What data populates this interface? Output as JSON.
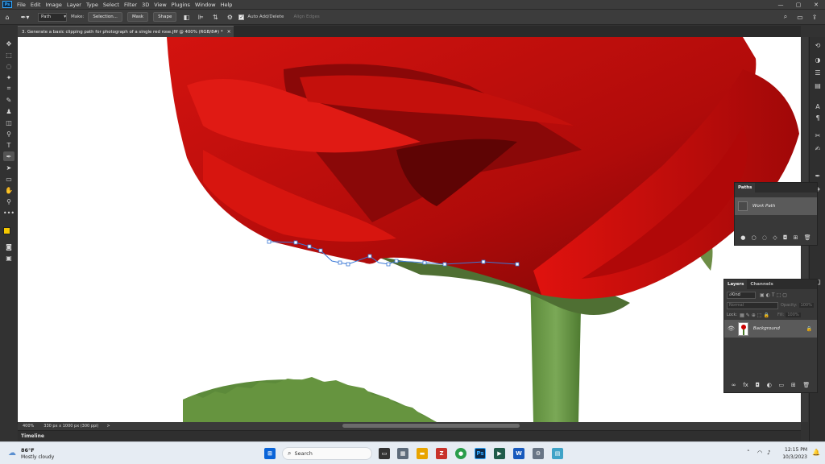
{
  "menu": [
    "File",
    "Edit",
    "Image",
    "Layer",
    "Type",
    "Select",
    "Filter",
    "3D",
    "View",
    "Plugins",
    "Window",
    "Help"
  ],
  "app_logo": "Ps",
  "window_controls": [
    "—",
    "▢",
    "✕"
  ],
  "options": {
    "mode_value": "Path",
    "make_label": "Make:",
    "selection_button": "Selection...",
    "mask_button": "Mask",
    "shape_button": "Shape",
    "auto_add_delete_label": "Auto Add/Delete",
    "auto_add_delete_check": "✓",
    "align_edges_label": "Align Edges"
  },
  "document": {
    "tab_title": "3. Generate a basic clipping path for photograph of a single red rose.jfif @ 400% (RGB/8#) *",
    "tab_close": "×"
  },
  "status": {
    "zoom": "400%",
    "dimensions": "330 px x 1000 px (300 ppi)",
    "arrow": ">"
  },
  "timeline_label": "Timeline",
  "paths_panel": {
    "tab": "Paths",
    "item": "Work Path"
  },
  "layers_panel": {
    "tabs": [
      "Layers",
      "Channels"
    ],
    "kind": "Kind",
    "blend": "Normal",
    "opacity_label": "Opacity:",
    "opacity_value": "100%",
    "lock_label": "Lock:",
    "fill_label": "Fill:",
    "fill_value": "100%",
    "layer_name": "Background"
  },
  "taskbar": {
    "temperature": "86°F",
    "weather": "Mostly cloudy",
    "search_placeholder": "Search",
    "time": "12:15 PM",
    "date": "10/3/2023"
  },
  "colors": {
    "foreground": "#f5c800",
    "background": "#000000",
    "path": "#3a78d6"
  }
}
